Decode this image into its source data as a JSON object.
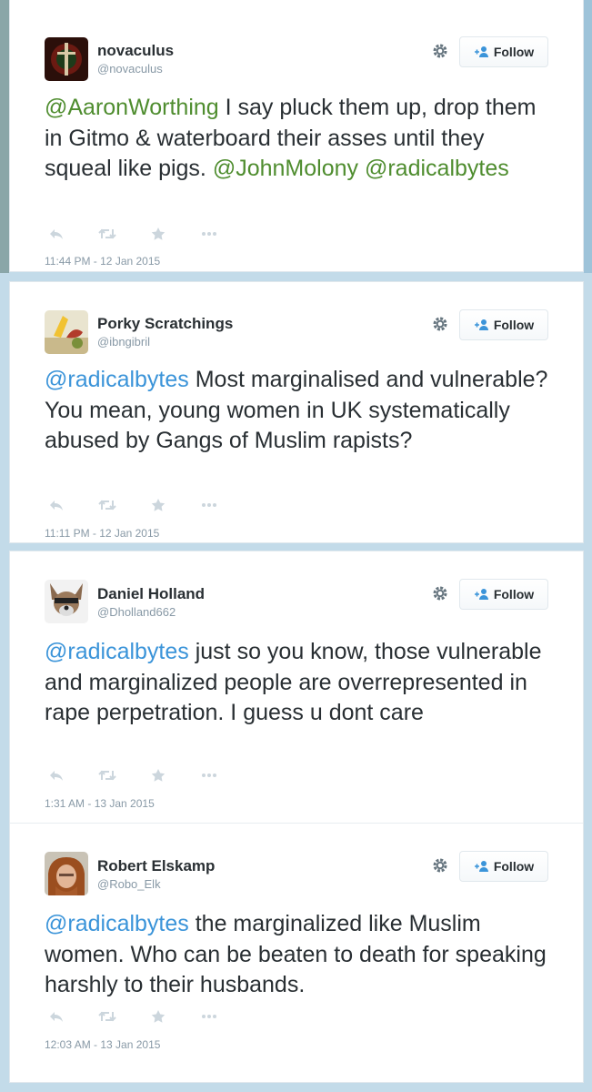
{
  "follow_label": "Follow",
  "colors": {
    "mention_blue": "#3b94d9",
    "mention_green": "#4f8d2f",
    "meta_gray": "#8899a6"
  },
  "tweets": [
    {
      "name": "novaculus",
      "handle": "@novaculus",
      "segments": [
        {
          "text": "@AaronWorthing",
          "mention": true
        },
        {
          "text": "  I say pluck them up, drop them in Gitmo & waterboard their asses until they squeal like pigs. ",
          "mention": false
        },
        {
          "text": "@JohnMolony",
          "mention": true
        },
        {
          "text": " ",
          "mention": false
        },
        {
          "text": "@radicalbytes",
          "mention": true
        }
      ],
      "timestamp": "11:44 PM - 12 Jan 2015"
    },
    {
      "name": "Porky Scratchings",
      "handle": "@ibngibril",
      "segments": [
        {
          "text": "@radicalbytes",
          "mention": true
        },
        {
          "text": " Most marginalised and vulnerable? You mean, young women in UK systematically abused by Gangs of Muslim rapists?",
          "mention": false
        }
      ],
      "timestamp": "11:11 PM - 12 Jan 2015"
    },
    {
      "name": "Daniel Holland",
      "handle": "@Dholland662",
      "segments": [
        {
          "text": "@radicalbytes",
          "mention": true
        },
        {
          "text": " just so you know, those vulnerable and marginalized people are overrepresented in rape perpetration. I guess u dont care",
          "mention": false
        }
      ],
      "timestamp": "1:31 AM - 13 Jan 2015"
    },
    {
      "name": "Robert Elskamp",
      "handle": "@Robo_Elk",
      "segments": [
        {
          "text": "@radicalbytes",
          "mention": true
        },
        {
          "text": " the marginalized like Muslim women. Who can be beaten to death for speaking harshly to their husbands.",
          "mention": false
        }
      ],
      "timestamp": "12:03 AM - 13 Jan 2015"
    }
  ]
}
